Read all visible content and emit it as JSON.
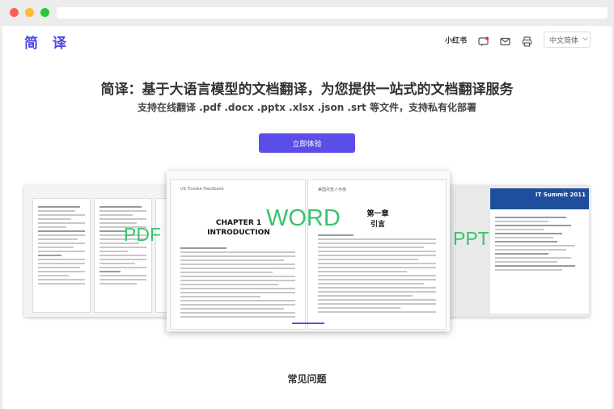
{
  "header": {
    "logo": "简 译",
    "author": "小红书",
    "icons": [
      "message-icon",
      "mail-icon",
      "printer-icon"
    ],
    "language": "中文简体"
  },
  "hero": {
    "title": "简译：基于大语言模型的文档翻译，为您提供一站式的文档翻译服务",
    "subtitle": "支持在线翻译 .pdf .docx .pptx .xlsx .json .srt 等文件，支持私有化部署",
    "cta": "立即体验"
  },
  "showcase": {
    "formats": [
      "PDF",
      "WORD",
      "PPT"
    ],
    "word_left_heading": "CHAPTER 1",
    "word_left_subheading": "INTRODUCTION",
    "word_left_running": "US Trustee Handbook",
    "word_right_heading": "第一章",
    "word_right_subheading": "引言",
    "word_right_running": "美国托管人手册",
    "ppt_banner": "IT Summit 2011"
  },
  "faq": {
    "title": "常见问题"
  },
  "colors": {
    "accent": "#5b4ee8",
    "format_label": "#39c36b",
    "logo": "#4f46e5"
  }
}
